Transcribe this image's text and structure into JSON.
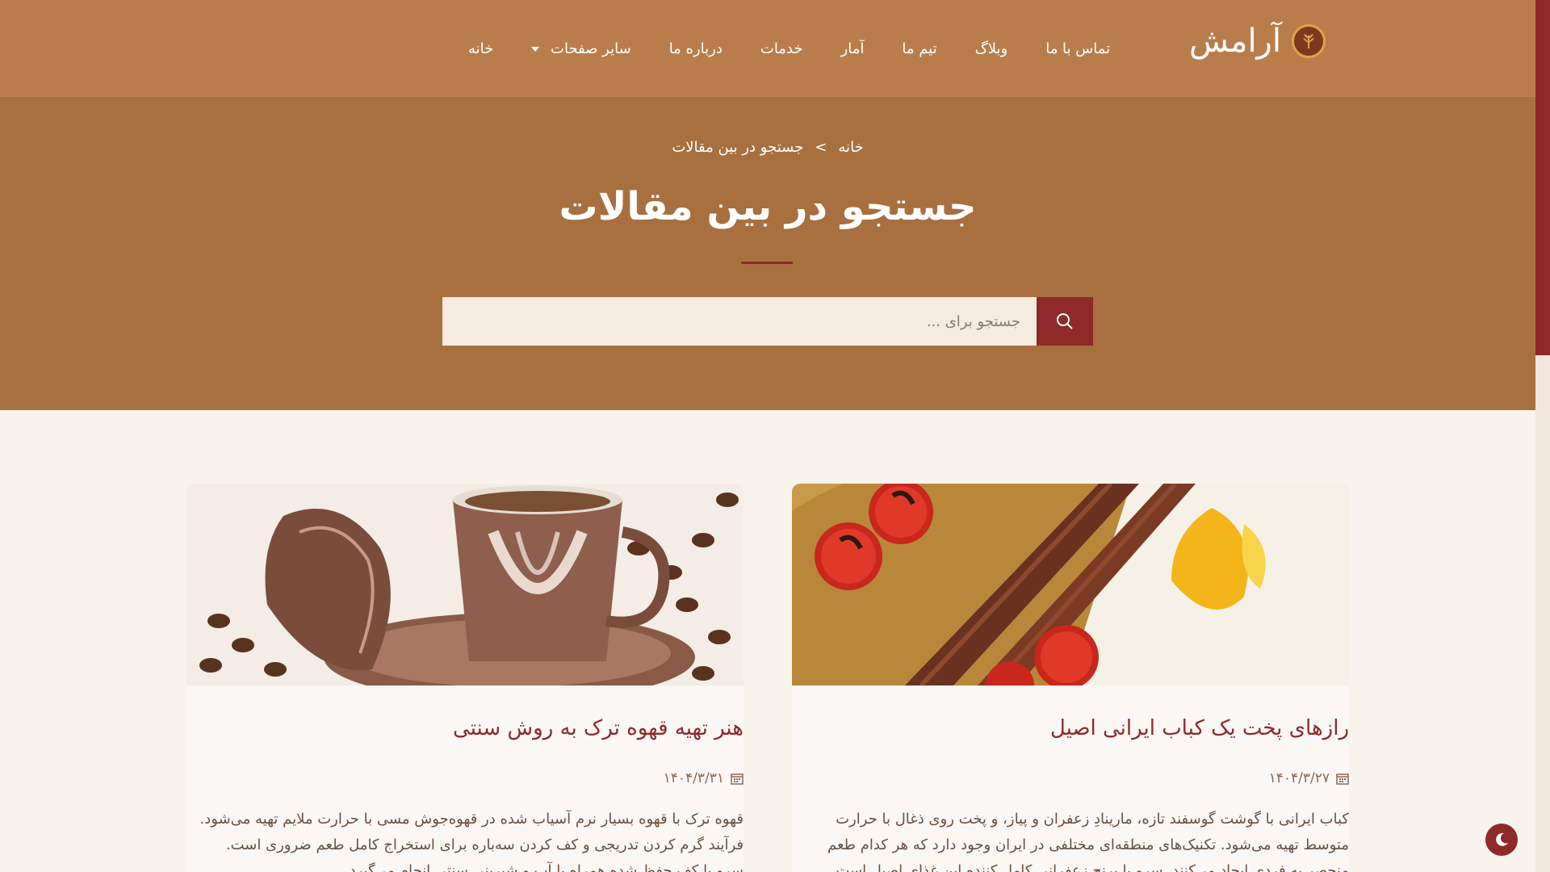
{
  "brand": {
    "name": "آرامش",
    "logo_icon": "wheat-leaf-icon"
  },
  "nav": {
    "items": [
      {
        "label": "خانه"
      },
      {
        "label": "سایر صفحات"
      },
      {
        "label": "درباره ما"
      },
      {
        "label": "خدمات"
      },
      {
        "label": "آمار"
      },
      {
        "label": "تیم ما"
      },
      {
        "label": "وبلاگ"
      },
      {
        "label": "تماس با ما"
      }
    ]
  },
  "breadcrumb": {
    "home": "خانه",
    "separator": ">",
    "current": "جستجو در بین مقالات"
  },
  "page": {
    "title": "جستجو در بین مقالات"
  },
  "search": {
    "placeholder": "جستجو برای ...",
    "value": "",
    "button_icon": "search-icon"
  },
  "cards": [
    {
      "title": "رازهای پخت یک کباب ایرانی اصیل",
      "date": "۱۴۰۴/۳/۲۷",
      "excerpt": "کباب ایرانی با گوشت گوسفند تازه، مارینادِ زعفران و پیاز، و پخت روی ذغال با حرارت متوسط تهیه می‌شود. تکنیک‌های منطقه‌ای مختلفی در ایران وجود دارد که هر کدام طعم منحصر به فردی ایجاد می‌کنند. سرو با برنج زعفرانی کامل کننده این غذای اصیل است.",
      "image_icon": "kebab-rice-image"
    },
    {
      "title": "هنر تهیه قهوه ترک به روش سنتی",
      "date": "۱۴۰۴/۳/۳۱",
      "excerpt": "قهوه ترک با قهوه بسیار نرم آسیاب شده در قهوه‌جوش مسی با حرارت ملایم تهیه می‌شود. فرآیند گرم کردن تدریجی و کف کردن سه‌باره برای استخراج کامل طعم ضروری است. سرو با کف حفظ شده همراه با آب و شیرینی سنتی انجام می‌گیرد.",
      "image_icon": "turkish-coffee-image"
    }
  ],
  "theme_toggle": {
    "icon": "moon-icon"
  },
  "colors": {
    "header": "#b97d4b",
    "hero": "#a8703f",
    "accent": "#8e2a2a",
    "page_bg": "#f8f3ec"
  }
}
